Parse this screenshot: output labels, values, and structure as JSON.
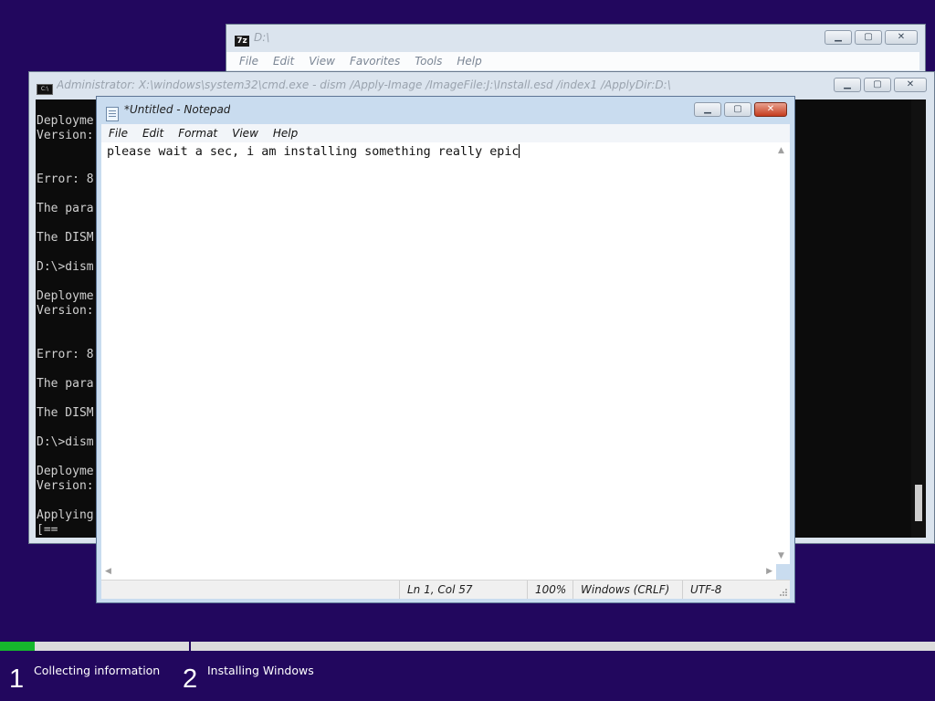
{
  "zip_window": {
    "icon_text": "7z",
    "title": "D:\\",
    "menu": [
      "File",
      "Edit",
      "View",
      "Favorites",
      "Tools",
      "Help"
    ],
    "controls": {
      "minimize": "minimize-icon",
      "maximize": "maximize-icon",
      "close": "close-icon"
    }
  },
  "cmd_window": {
    "icon_text": "C:\\",
    "title": "Administrator: X:\\windows\\system32\\cmd.exe - dism  /Apply-Image /ImageFile:J:\\Install.esd /index1 /ApplyDir:D:\\",
    "lines": [
      "Deployme",
      "Version:",
      "",
      "",
      "Error: 8",
      "",
      "The para",
      "",
      "The DISM",
      "",
      "D:\\>dism",
      "",
      "Deployme",
      "Version:",
      "",
      "",
      "Error: 8",
      "",
      "The para",
      "",
      "The DISM",
      "",
      "D:\\>dism",
      "",
      "Deployme",
      "Version:",
      "",
      "Applying",
      "[=="
    ]
  },
  "notepad": {
    "title": "*Untitled - Notepad",
    "menu": [
      "File",
      "Edit",
      "Format",
      "View",
      "Help"
    ],
    "text": "please wait a sec, i am installing something really epic",
    "status": {
      "position": "Ln 1, Col 57",
      "zoom": "100%",
      "line_ending": "Windows (CRLF)",
      "encoding": "UTF-8"
    }
  },
  "setup": {
    "progress_percent": 3.7,
    "steps": [
      {
        "number": "1",
        "label": "Collecting information"
      },
      {
        "number": "2",
        "label": "Installing Windows"
      }
    ],
    "colors": {
      "background": "#22075e",
      "progress_fill": "#16b72d",
      "track": "#dcdcdc"
    }
  }
}
